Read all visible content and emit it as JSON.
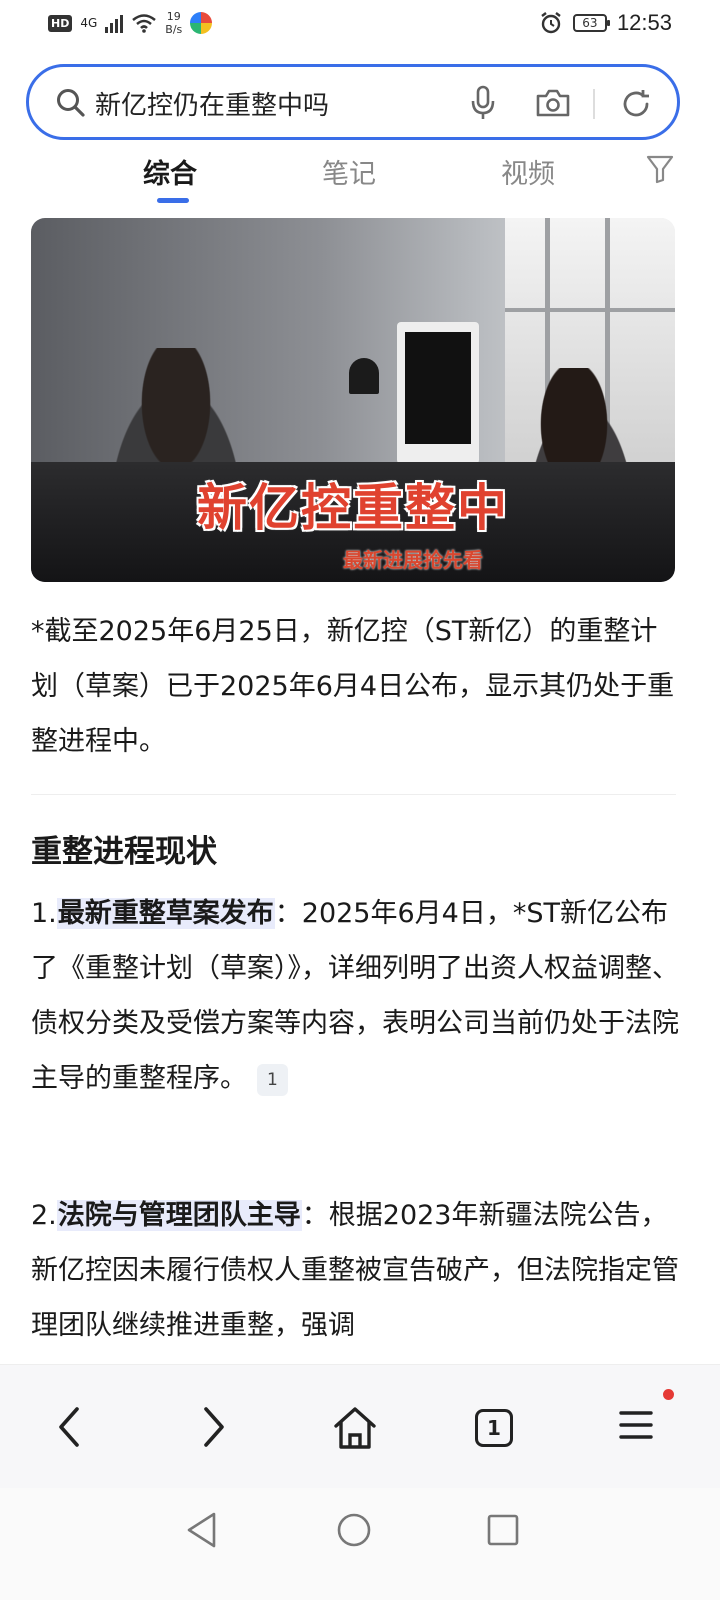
{
  "status_bar": {
    "hd": "HD",
    "network": "4G",
    "speed_value": "19",
    "speed_unit": "B/s",
    "battery": "63",
    "time": "12:53"
  },
  "search": {
    "query": "新亿控仍在重整中吗"
  },
  "tabs": [
    {
      "label": "综合",
      "active": true
    },
    {
      "label": "笔记",
      "active": false
    },
    {
      "label": "视频",
      "active": false
    }
  ],
  "hero": {
    "title": "新亿控重整中",
    "subtitle": "最新进展抢先看"
  },
  "intro": "*截至2025年6月25日，新亿控（ST新亿）的重整计划（草案）已于2025年6月4日公布，显示其仍处于重整进程中。",
  "section": {
    "heading": "重整进程现状"
  },
  "items": [
    {
      "number": "1.",
      "highlight": "最新重整草案发布",
      "text": "：2025年6月4日，*ST新亿公布了《重整计划（草案）》，详细列明了出资人权益调整、债权分类及受偿方案等内容，表明公司当前仍处于法院主导的重整程序。",
      "citation": "1"
    },
    {
      "number": "2.",
      "highlight": "法院与管理团队主导",
      "text": "：根据2023年新疆法院公告，新亿控因未履行债权人重整被宣告破产，但法院指定管理团队继续推进重整，强调"
    }
  ],
  "toolbar": {
    "tab_count": "1"
  },
  "icons": {
    "accent": "#3a6ee8",
    "highlight_bg": "#e8ebfb",
    "notify": "#e53935"
  }
}
